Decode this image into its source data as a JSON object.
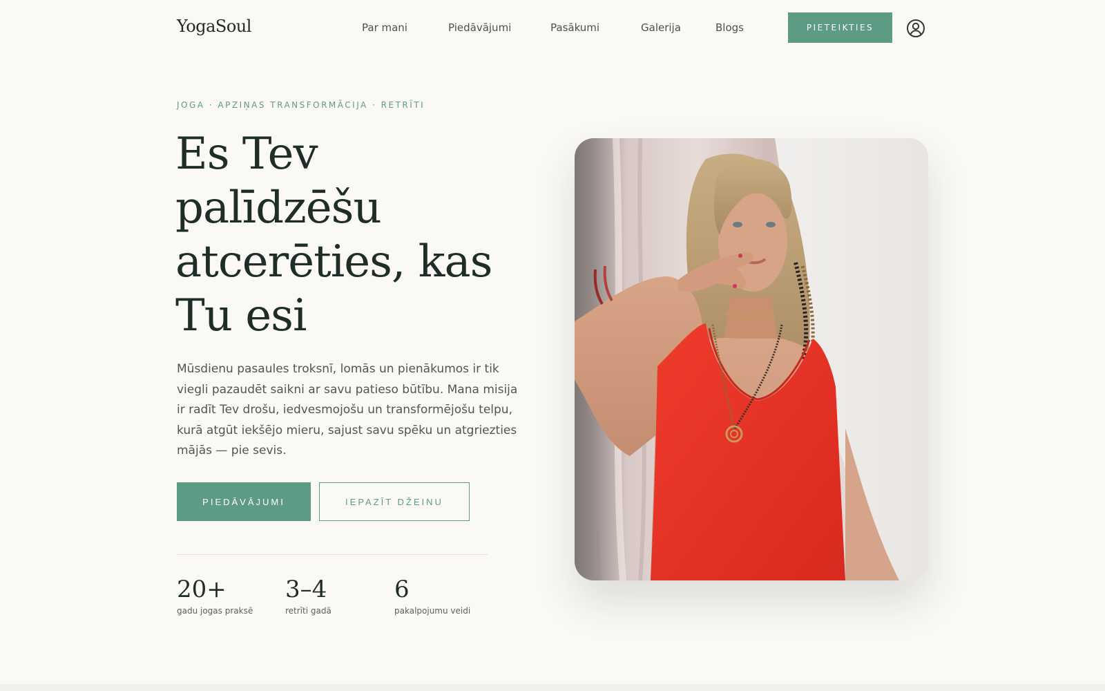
{
  "brand": {
    "logo": "YogaSoul",
    "accent": "#5e9b84",
    "background": "#faf9f5"
  },
  "nav": {
    "items": [
      {
        "label": "Par mani"
      },
      {
        "label": "Piedāvājumi"
      },
      {
        "label": "Pasākumi"
      },
      {
        "label": "Galerija"
      },
      {
        "label": "Blogs"
      }
    ],
    "signup_label": "PIETEIKTIES",
    "account_icon": "user-circle-icon"
  },
  "hero": {
    "eyebrow": "JOGA · APZIŅAS TRANSFORMĀCIJA · RETRĪTI",
    "headline": "Es Tev palīdzēšu atcerēties, kas Tu esi",
    "intro": "Mūsdienu pasaules troksnī, lomās un pienākumos ir tik viegli pazaudēt saikni ar savu patieso būtību. Mana misija ir radīt Tev drošu, iedvesmojošu un transformējošu telpu, kurā atgūt iekšējo mieru, sajust savu spēku un atgriezties mājās — pie sevis.",
    "primary_button": "PIEDĀVĀJUMI",
    "secondary_button": "IEPAZĪT DŽEINU",
    "stats": [
      {
        "value": "20+",
        "label": "gadu jogas praksē"
      },
      {
        "value": "3–4",
        "label": "retrīti gadā"
      },
      {
        "value": "6",
        "label": "pakalpojumu veidi"
      }
    ]
  }
}
